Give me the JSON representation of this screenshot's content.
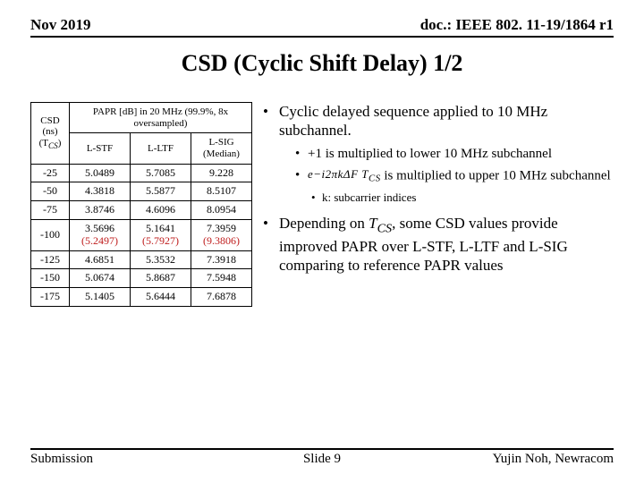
{
  "header": {
    "left": "Nov 2019",
    "right": "doc.: IEEE 802. 11-19/1864 r1"
  },
  "title": "CSD (Cyclic Shift Delay) 1/2",
  "table": {
    "topHeader": "PAPR [dB] in 20 MHz (99.9%, 8x oversampled)",
    "cols": {
      "c0a": "CSD (ns)",
      "c0b": "(T",
      "c0bSub": "CS",
      "c0bEnd": ")",
      "c1": "L-STF",
      "c2": "L-LTF",
      "c3a": "L-SIG",
      "c3b": "(Median)"
    },
    "rows": [
      {
        "csd": "-25",
        "a": "5.0489",
        "b": "5.7085",
        "c": "9.228"
      },
      {
        "csd": "-50",
        "a": "4.3818",
        "b": "5.5877",
        "c": "8.5107"
      },
      {
        "csd": "-75",
        "a": "3.8746",
        "b": "4.6096",
        "c": "8.0954"
      },
      {
        "csd": "-100",
        "a": "3.5696",
        "a2": "(5.2497)",
        "b": "5.1641",
        "b2": "(5.7927)",
        "c": "7.3959",
        "c2": "(9.3806)",
        "red": true
      },
      {
        "csd": "-125",
        "a": "4.6851",
        "b": "5.3532",
        "c": "7.3918"
      },
      {
        "csd": "-150",
        "a": "5.0674",
        "b": "5.8687",
        "c": "7.5948"
      },
      {
        "csd": "-175",
        "a": "5.1405",
        "b": "5.6444",
        "c": "7.6878"
      }
    ]
  },
  "bullets": {
    "p1": "Cyclic delayed sequence applied to 10 MHz subchannel.",
    "p1a": "+1 is multiplied to lower 10 MHz subchannel",
    "p1b_expr": "e−i2πkΔF T",
    "p1b_sub": "CS",
    "p1b_tail": " is multiplied to upper 10 MHz subchannel",
    "p1c": "k: subcarrier indices",
    "p2a": "Depending on ",
    "p2_T": "T",
    "p2_sub": "CS",
    "p2b": ", some CSD values provide improved PAPR over L-STF, L-LTF and L-SIG comparing to reference PAPR values"
  },
  "footer": {
    "left": "Submission",
    "mid": "Slide 9",
    "right": "Yujin Noh, Newracom"
  }
}
